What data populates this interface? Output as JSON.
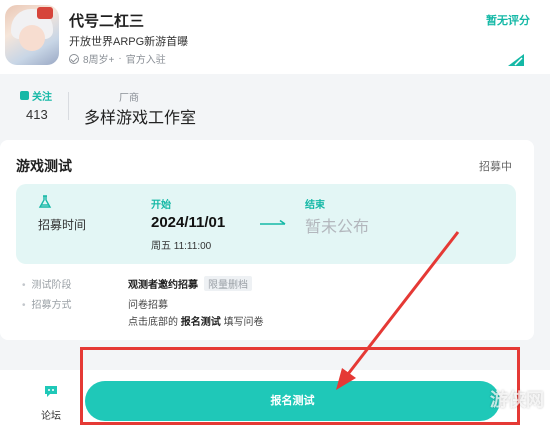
{
  "header": {
    "title": "代号二杠三",
    "tagline": "开放世界ARPG新游首曝",
    "age_rating": "8周岁+",
    "separator": "·",
    "official": "官方入驻",
    "score_status": "暂无评分",
    "icons": {
      "check": "check-circle-icon",
      "badge": "corner-badge-icon"
    }
  },
  "stats": {
    "follow_label": "关注",
    "follow_count": "413",
    "vendor_label": "厂商",
    "vendor_name": "多样游戏工作室"
  },
  "test_card": {
    "title": "游戏测试",
    "status": "招募中",
    "recruit_label": "招募时间",
    "start_label": "开始",
    "start_date": "2024/11/01",
    "start_time": "周五 11:11:00",
    "end_label": "结束",
    "end_value": "暂未公布",
    "details": [
      {
        "key": "测试阶段",
        "value": "观测者邀约招募",
        "tag": "限量删档"
      },
      {
        "key": "招募方式",
        "value": "问卷招募"
      }
    ],
    "instruction_prefix": "点击底部的",
    "instruction_bold": "报名测试",
    "instruction_suffix": "填写问卷"
  },
  "bottom_bar": {
    "forum_label": "论坛",
    "signup_label": "报名测试"
  },
  "watermark": "游侠网",
  "colors": {
    "accent": "#1fc8b8",
    "annotation": "#e53935",
    "timebox_bg": "#e3f6f5"
  }
}
